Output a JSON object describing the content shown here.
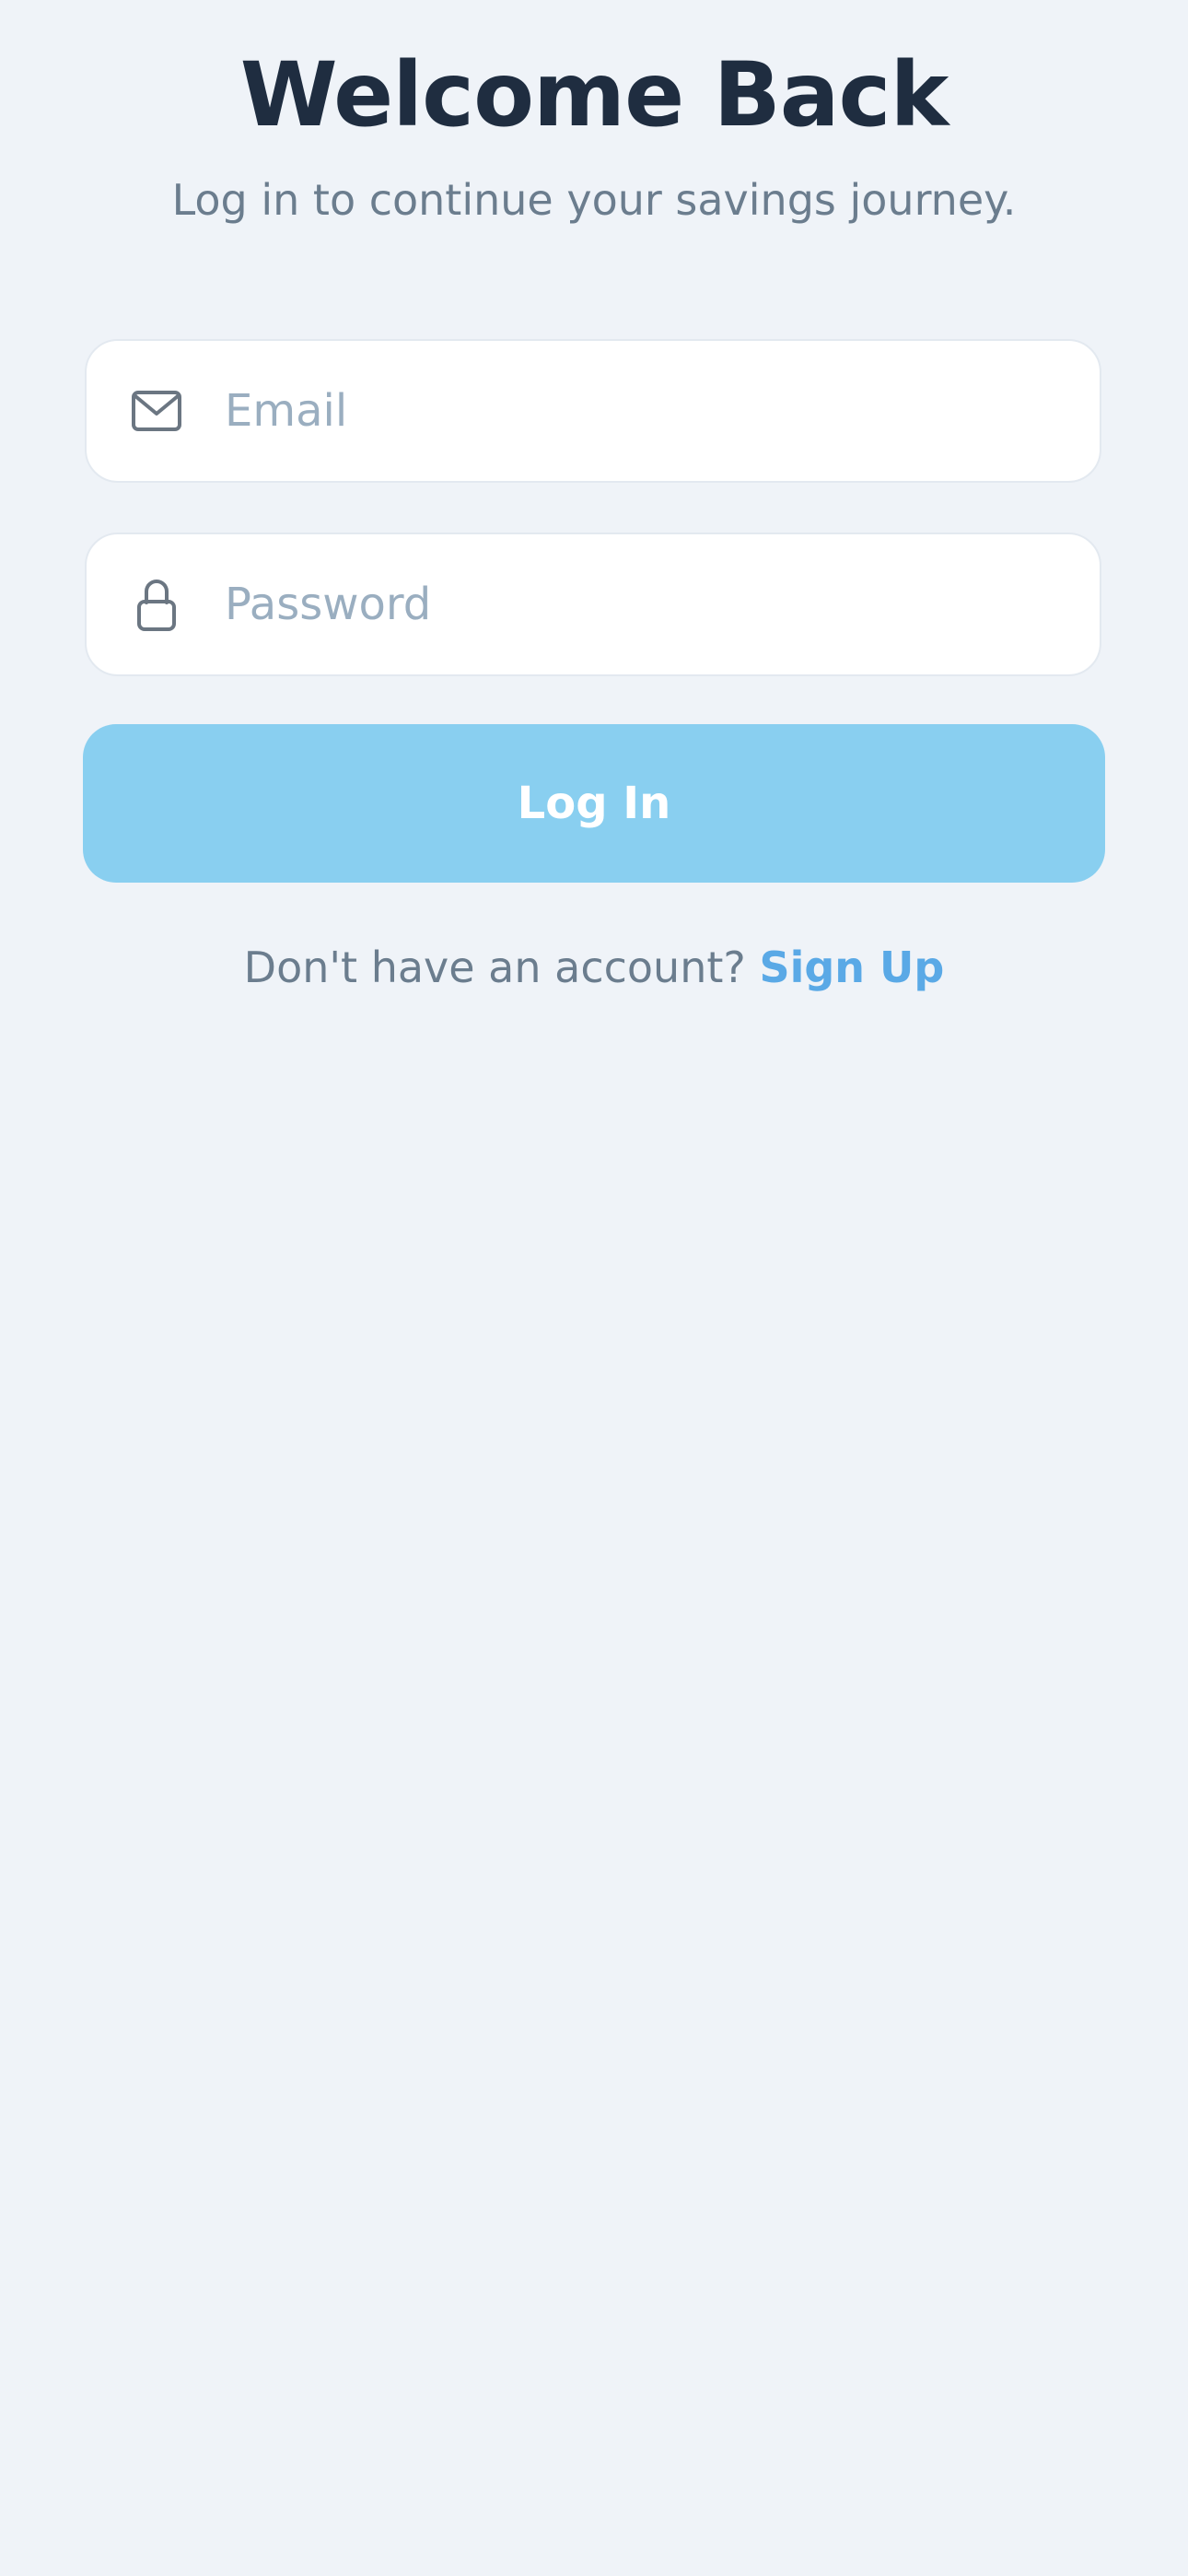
{
  "header": {
    "title": "Welcome Back",
    "subtitle": "Log in to continue your savings journey."
  },
  "form": {
    "email": {
      "placeholder": "Email",
      "value": "",
      "icon": "envelope-icon"
    },
    "password": {
      "placeholder": "Password",
      "value": "",
      "icon": "lock-icon"
    },
    "login_label": "Log In"
  },
  "footer": {
    "prompt": "Don't have an account?",
    "signup_label": "Sign Up"
  },
  "colors": {
    "background": "#eff3f8",
    "title": "#1f2d40",
    "muted_text": "#6b7d8e",
    "placeholder": "#9aaec0",
    "button": "#89cff0",
    "link": "#5aa9e6"
  }
}
